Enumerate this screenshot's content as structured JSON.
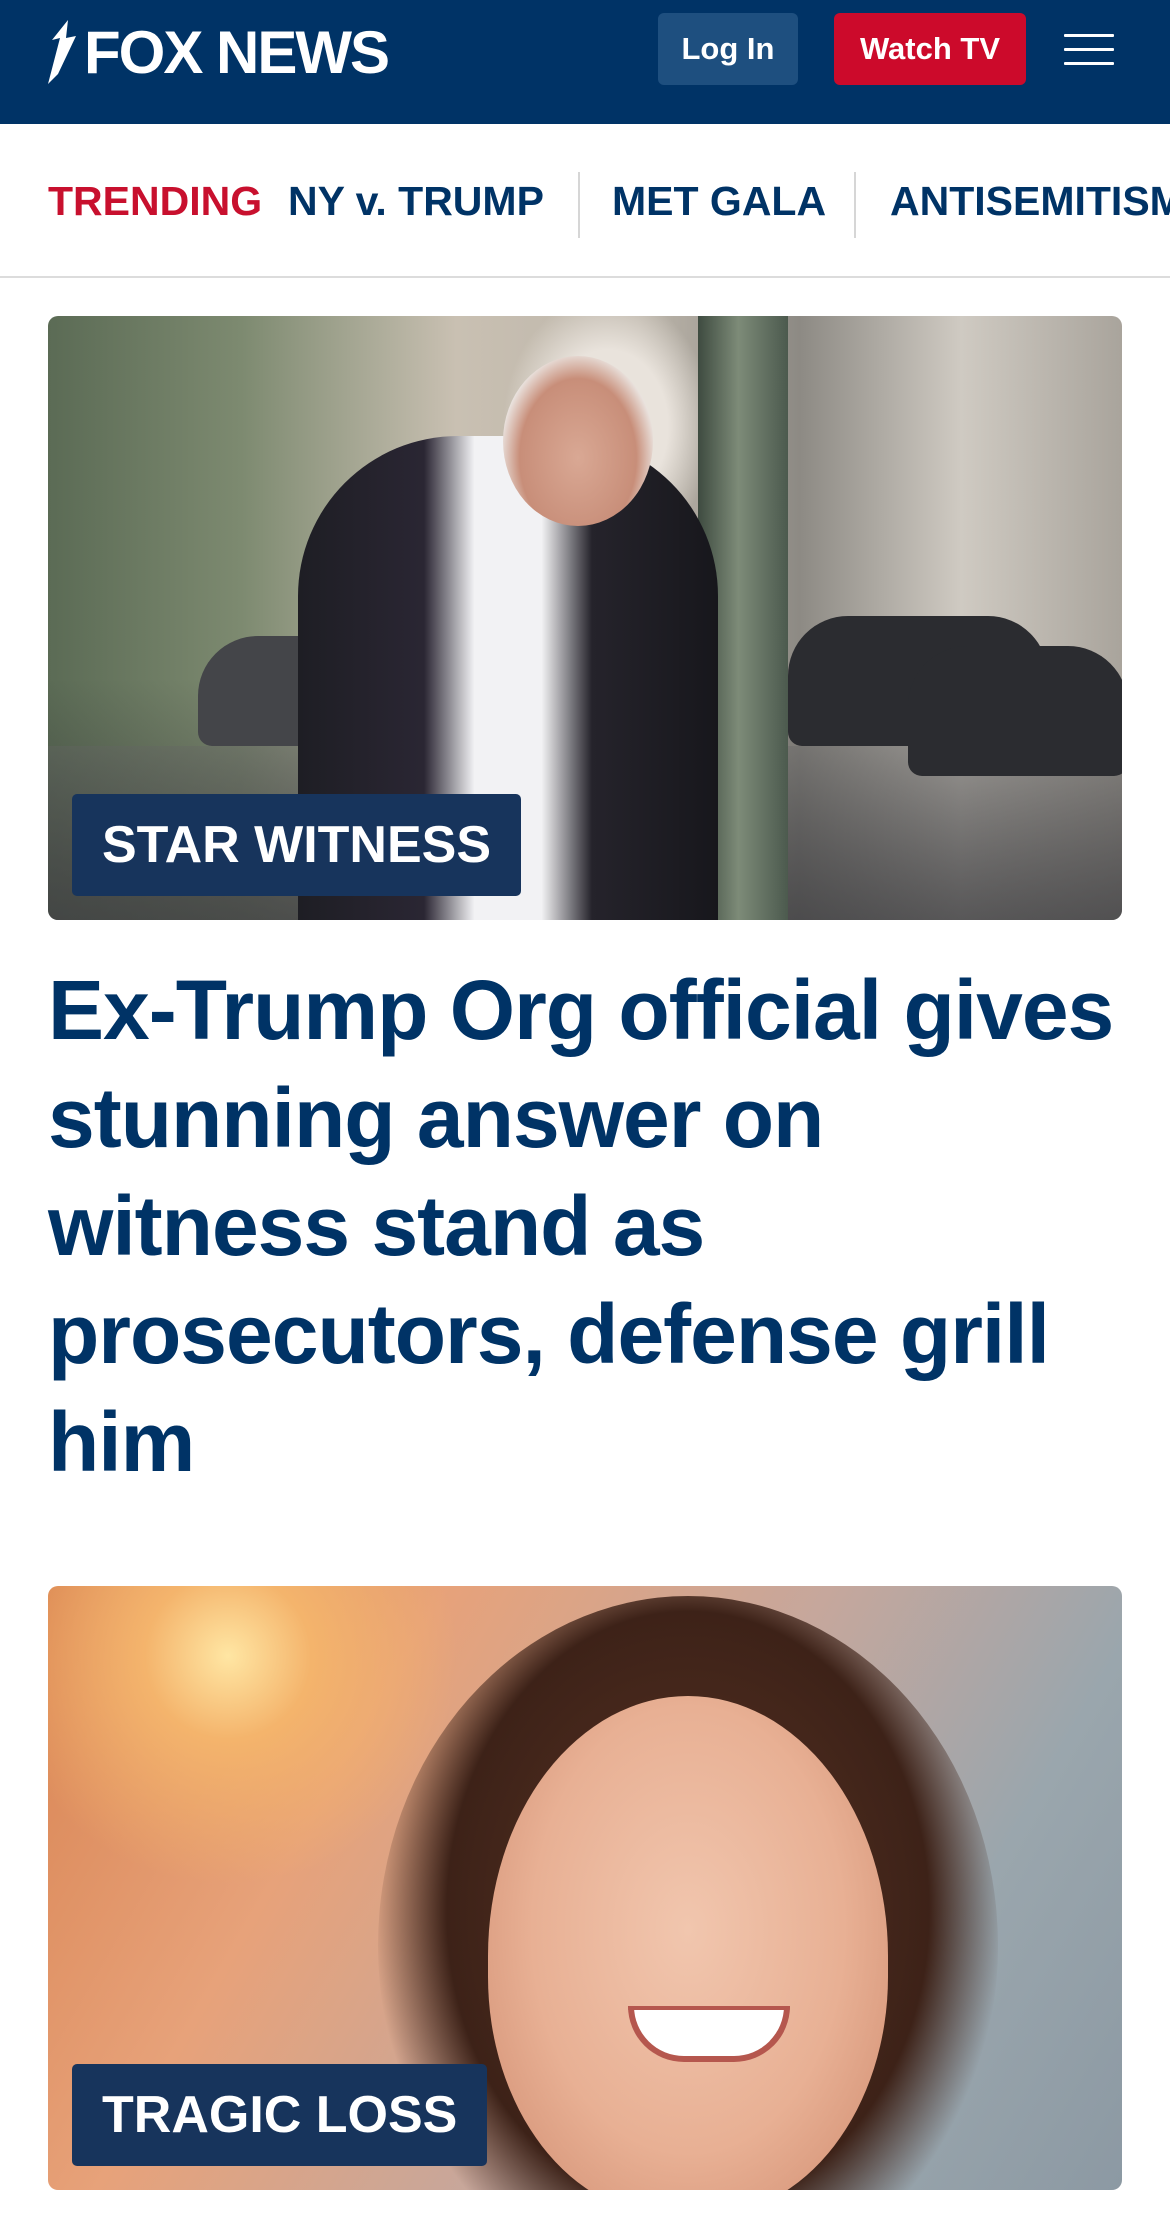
{
  "header": {
    "logo_text": "FOX NEWS",
    "login_label": "Log In",
    "watch_label": "Watch TV",
    "colors": {
      "background": "#003366",
      "login_bg": "#1e4f7f",
      "watch_bg": "#cc0a2b"
    }
  },
  "trending": {
    "label": "TRENDING",
    "items": [
      {
        "label": "NY v. TRUMP"
      },
      {
        "label": "MET GALA"
      },
      {
        "label": "ANTISEMITISM"
      }
    ],
    "colors": {
      "label": "#c8102e",
      "item": "#003366"
    }
  },
  "stories": [
    {
      "label": "STAR WITNESS",
      "headline": "Ex-Trump Org official gives stunning answer on witness stand as prosecutors, defense grill him"
    },
    {
      "label": "TRAGIC LOSS"
    }
  ],
  "icons": {
    "menu": "hamburger-menu-icon",
    "logo_mark": "fox-logo-mark-icon"
  }
}
